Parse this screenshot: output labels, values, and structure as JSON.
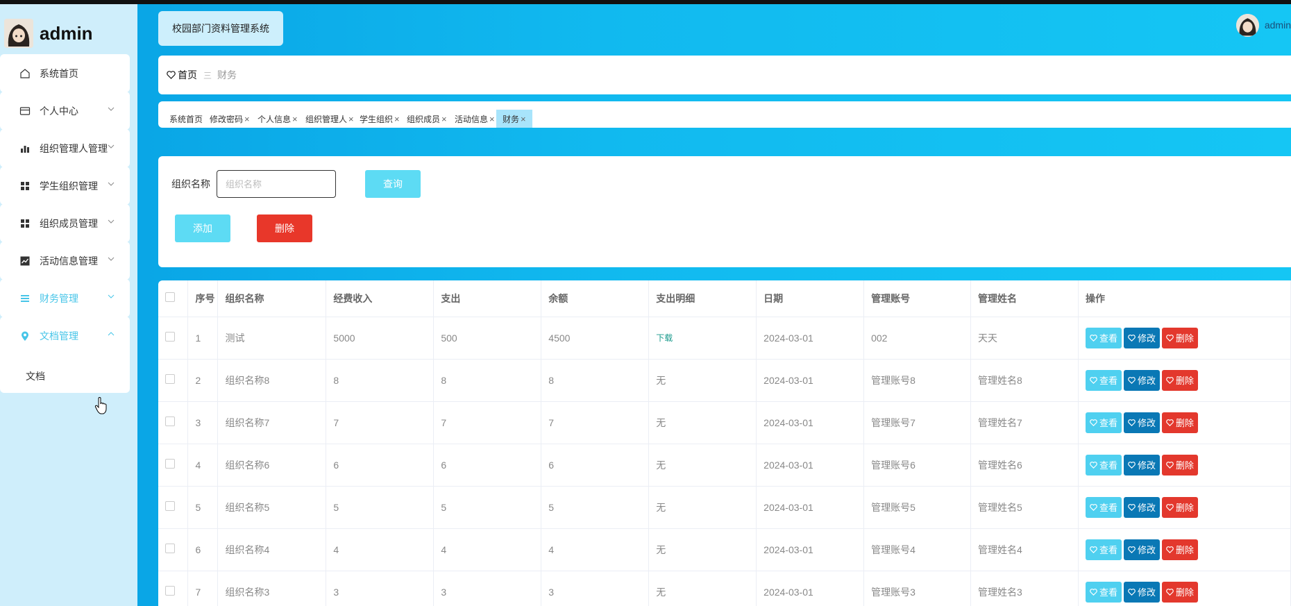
{
  "sidebar": {
    "username": "admin",
    "items": [
      {
        "label": "系统首页",
        "icon": "home-icon"
      },
      {
        "label": "个人中心",
        "icon": "card-icon"
      },
      {
        "label": "组织管理人管理",
        "icon": "bar-chart-icon"
      },
      {
        "label": "学生组织管理",
        "icon": "grid-icon"
      },
      {
        "label": "组织成员管理",
        "icon": "grid-icon"
      },
      {
        "label": "活动信息管理",
        "icon": "trend-chart-icon"
      },
      {
        "label": "财务管理",
        "icon": "list-icon"
      },
      {
        "label": "文档管理",
        "icon": "location-pin-icon"
      }
    ],
    "submenu": {
      "label": "文档"
    }
  },
  "header": {
    "system_title": "校园部门资料管理系统",
    "user": "admin"
  },
  "breadcrumb": {
    "home": "首页",
    "separator": "三",
    "current": "财务"
  },
  "tabs": [
    {
      "label": "系统首页",
      "closable": false
    },
    {
      "label": "修改密码",
      "closable": true
    },
    {
      "label": "个人信息",
      "closable": true
    },
    {
      "label": "组织管理人",
      "closable": true
    },
    {
      "label": "学生组织",
      "closable": true
    },
    {
      "label": "组织成员",
      "closable": true
    },
    {
      "label": "活动信息",
      "closable": true
    },
    {
      "label": "财务",
      "closable": true,
      "active": true
    }
  ],
  "tab_close_glyph": "×",
  "search": {
    "label": "组织名称",
    "placeholder": "组织名称",
    "query_button": "查询",
    "add_button": "添加",
    "delete_button": "删除"
  },
  "table": {
    "headers": [
      "序号",
      "组织名称",
      "经费收入",
      "支出",
      "余额",
      "支出明细",
      "日期",
      "管理账号",
      "管理姓名",
      "操作"
    ],
    "actions": {
      "view": "查看",
      "edit": "修改",
      "delete": "删除"
    },
    "rows": [
      [
        "1",
        "测试",
        "5000",
        "500",
        "4500",
        "下载",
        "2024-03-01",
        "002",
        "天天"
      ],
      [
        "2",
        "组织名称8",
        "8",
        "8",
        "8",
        "无",
        "2024-03-01",
        "管理账号8",
        "管理姓名8"
      ],
      [
        "3",
        "组织名称7",
        "7",
        "7",
        "7",
        "无",
        "2024-03-01",
        "管理账号7",
        "管理姓名7"
      ],
      [
        "4",
        "组织名称6",
        "6",
        "6",
        "6",
        "无",
        "2024-03-01",
        "管理账号6",
        "管理姓名6"
      ],
      [
        "5",
        "组织名称5",
        "5",
        "5",
        "5",
        "无",
        "2024-03-01",
        "管理账号5",
        "管理姓名5"
      ],
      [
        "6",
        "组织名称4",
        "4",
        "4",
        "4",
        "无",
        "2024-03-01",
        "管理账号4",
        "管理姓名4"
      ],
      [
        "7",
        "组织名称3",
        "3",
        "3",
        "3",
        "无",
        "2024-03-01",
        "管理账号3",
        "管理姓名3"
      ]
    ]
  },
  "colors": {
    "accent": "#47c5e8",
    "header_gradient_start": "#0aa6e6",
    "header_gradient_end": "#15c6f4",
    "sidebar_bg": "#cfeefb",
    "danger": "#e8372a",
    "edit": "#0a78b5"
  }
}
